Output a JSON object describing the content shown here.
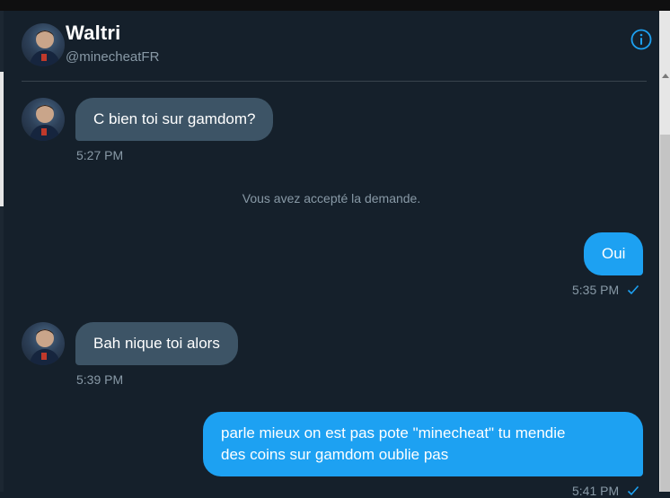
{
  "header": {
    "name": "Waltri",
    "handle": "@minecheatFR",
    "avatar_icon": "profile-photo",
    "info_icon": "info-circle-icon"
  },
  "colors": {
    "background": "#15202b",
    "incoming_bubble": "#3d5466",
    "outgoing_bubble": "#1da1f2",
    "muted_text": "#8899a6",
    "accent": "#1da1f2"
  },
  "messages": [
    {
      "direction": "incoming",
      "text": "C bien toi sur gamdom?",
      "time": "5:27 PM"
    },
    {
      "direction": "system",
      "text": "Vous avez accepté la demande."
    },
    {
      "direction": "outgoing",
      "text": "Oui",
      "time": "5:35 PM",
      "status_icon": "check-icon"
    },
    {
      "direction": "incoming",
      "text": "Bah nique toi alors",
      "time": "5:39 PM"
    },
    {
      "direction": "outgoing",
      "lines": [
        "parle mieux on est pas pote \"minecheat\" tu mendie",
        "des coins sur gamdom oublie pas"
      ],
      "time": "5:41 PM",
      "status_icon": "check-icon"
    }
  ]
}
